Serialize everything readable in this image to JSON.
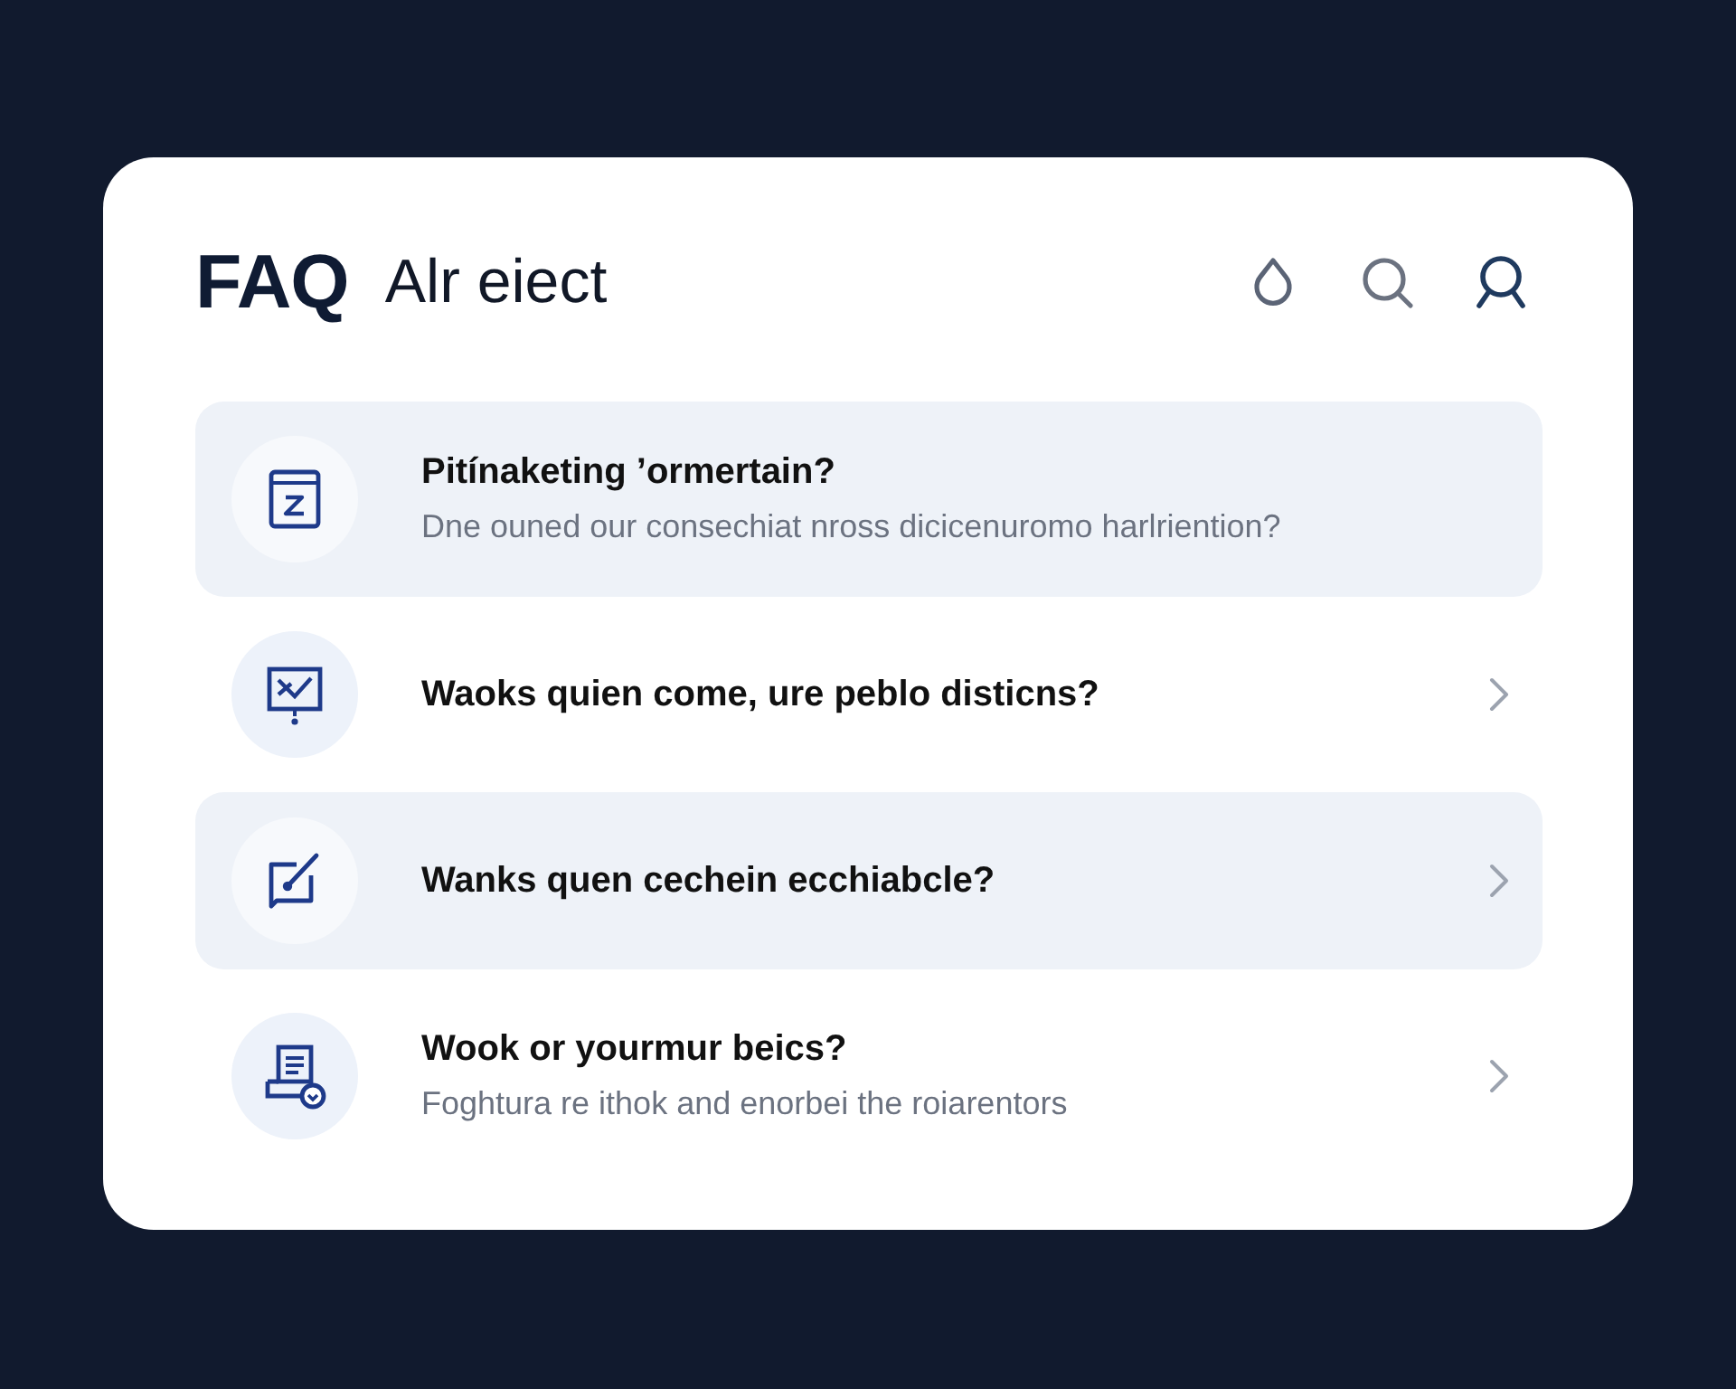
{
  "header": {
    "title": "FAQ",
    "subtitle": "Alr eiect"
  },
  "faq_items": [
    {
      "question": "Pitínaketing ’ormertain?",
      "answer": "Dne ouned our consechiat nross dicicenuromo harlriention?",
      "highlighted": true,
      "expanded": true
    },
    {
      "question": "Waoks quien come, ure peblo disticns?",
      "highlighted": false,
      "expanded": false
    },
    {
      "question": "Wanks quen cechein ecchiabcle?",
      "highlighted": true,
      "expanded": false
    },
    {
      "question": "Wook or yourmur beics?",
      "answer": "Foghtura re ithok and enorbei the roiarentors",
      "highlighted": false,
      "expanded": false
    }
  ]
}
